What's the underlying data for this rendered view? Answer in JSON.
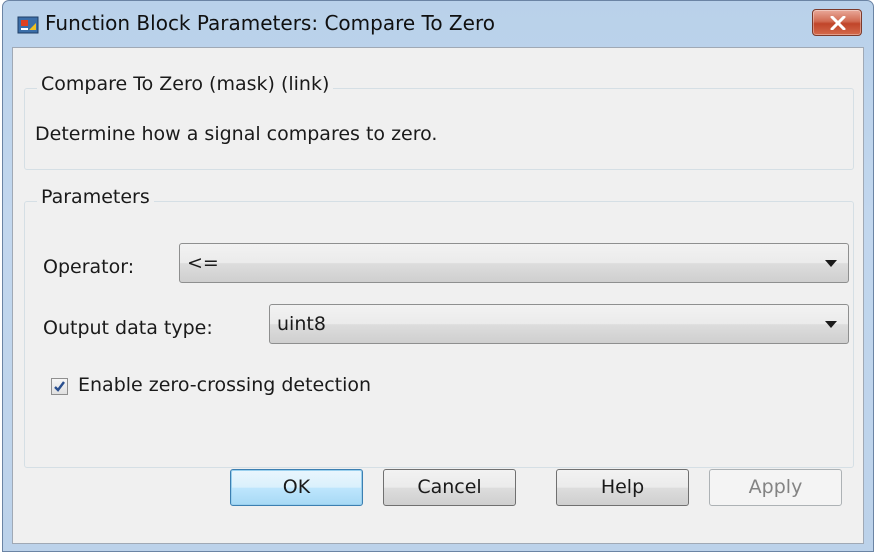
{
  "window": {
    "title": "Function Block Parameters: Compare To Zero"
  },
  "description_group": {
    "legend": "Compare To Zero (mask) (link)",
    "text": "Determine how a signal compares to zero."
  },
  "parameters_group": {
    "legend": "Parameters",
    "operator": {
      "label": "Operator:",
      "value": "<="
    },
    "output_data_type": {
      "label": "Output data type:",
      "value": "uint8"
    },
    "zero_crossing": {
      "label": "Enable zero-crossing detection",
      "checked": true
    }
  },
  "buttons": {
    "ok": "OK",
    "cancel": "Cancel",
    "help": "Help",
    "apply": "Apply"
  },
  "icons": {
    "app": "simulink-block-icon",
    "close": "close-icon",
    "dropdown": "chevron-down-icon",
    "check": "checkmark-icon"
  },
  "colors": {
    "close_button": "#c0452a",
    "default_button_border": "#3c7fb1",
    "checkmark": "#2a4f8f"
  }
}
